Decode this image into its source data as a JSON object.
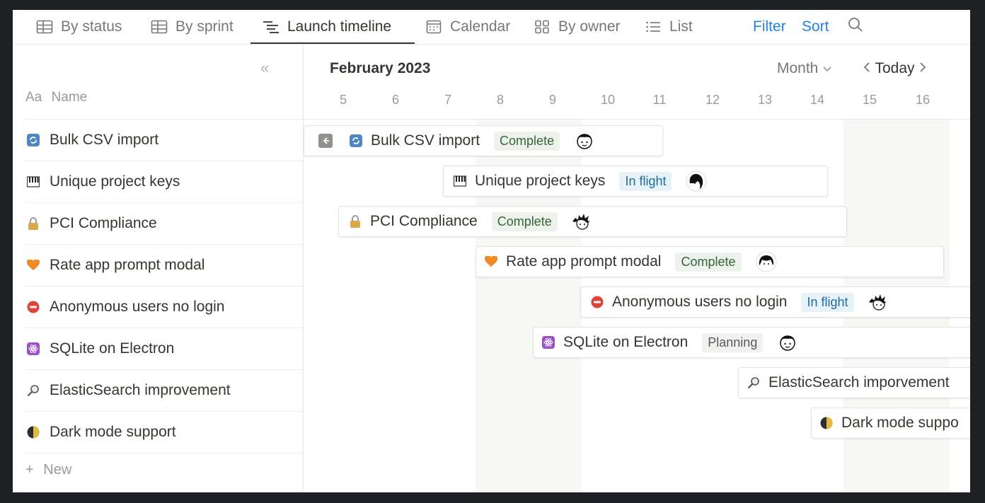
{
  "tabs": [
    {
      "label": "By status",
      "icon": "table-icon"
    },
    {
      "label": "By sprint",
      "icon": "table-icon"
    },
    {
      "label": "Launch timeline",
      "icon": "timeline-icon",
      "active": true
    },
    {
      "label": "Calendar",
      "icon": "calendar-icon"
    },
    {
      "label": "By owner",
      "icon": "board-icon"
    },
    {
      "label": "List",
      "icon": "list-icon"
    }
  ],
  "toolbar": {
    "filter": "Filter",
    "sort": "Sort"
  },
  "left": {
    "collapse_glyph": "«",
    "header_prefix": "Aa",
    "header_label": "Name",
    "new_label": "New",
    "new_glyph": "+"
  },
  "timeline": {
    "month": "February 2023",
    "view": "Month",
    "today": "Today",
    "days": [
      "5",
      "6",
      "7",
      "8",
      "9",
      "10",
      "11",
      "12",
      "13",
      "14",
      "15",
      "16"
    ]
  },
  "rows": [
    {
      "name": "Bulk CSV import",
      "icon": "sync-icon",
      "status": "Complete",
      "bar_name": "Bulk CSV import"
    },
    {
      "name": "Unique project keys",
      "icon": "piano-icon",
      "status": "In flight",
      "bar_name": "Unique project keys"
    },
    {
      "name": "PCI Compliance",
      "icon": "lock-icon",
      "status": "Complete",
      "bar_name": "PCI Compliance"
    },
    {
      "name": "Rate app prompt modal",
      "icon": "heart-icon",
      "status": "Complete",
      "bar_name": "Rate app prompt modal"
    },
    {
      "name": "Anonymous users no login",
      "icon": "no-entry-icon",
      "status": "In flight",
      "bar_name": "Anonymous users no login"
    },
    {
      "name": "SQLite on Electron",
      "icon": "atom-icon",
      "status": "Planning",
      "bar_name": "SQLite on Electron"
    },
    {
      "name": "ElasticSearch improvement",
      "icon": "magnifier-icon",
      "status": "",
      "bar_name": "ElasticSearch imporvement"
    },
    {
      "name": "Dark mode support",
      "icon": "moon-icon",
      "status": "",
      "bar_name": "Dark mode suppo"
    }
  ],
  "colors": {
    "accent": "#2383e2",
    "complete_bg": "#edf3ec",
    "flight_bg": "#e7f3f8",
    "planning_bg": "#f1f1ef"
  }
}
